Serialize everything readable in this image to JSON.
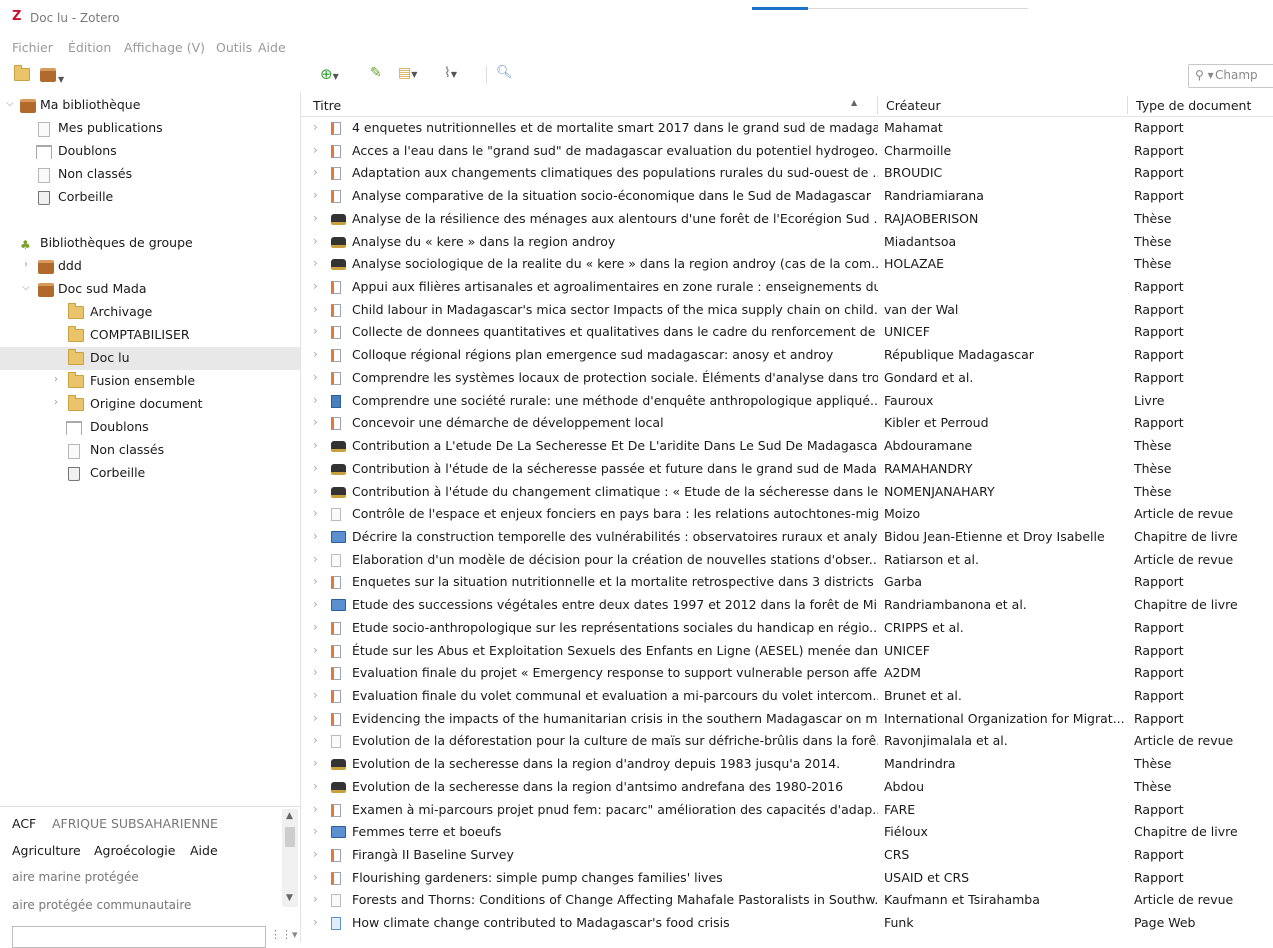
{
  "window": {
    "title": "Doc lu - Zotero",
    "logo": "Z"
  },
  "menu": [
    "Fichier",
    "Édition",
    "Affichage (V)",
    "Outils",
    "Aide"
  ],
  "toolbar": {
    "search_placeholder": "Champ"
  },
  "sidebar": {
    "my_library": "Ma bibliothèque",
    "my_items": [
      "Mes publications",
      "Doublons",
      "Non classés",
      "Corbeille"
    ],
    "groups_header": "Bibliothèques de groupe",
    "groups": [
      {
        "label": "ddd"
      },
      {
        "label": "Doc sud Mada"
      }
    ],
    "doc_sud_children": [
      "Archivage",
      "COMPTABILISER",
      "Doc lu",
      "Fusion ensemble",
      "Origine document",
      "Doublons",
      "Non classés",
      "Corbeille"
    ]
  },
  "tags": {
    "row1": [
      "ACF",
      "AFRIQUE SUBSAHARIENNE"
    ],
    "row2": [
      "Agriculture",
      "Agroécologie",
      "Aide"
    ],
    "row3": [
      "aire marine protégée"
    ],
    "row4": [
      "aire protégée communautaire"
    ]
  },
  "columns": {
    "title": "Titre",
    "creator": "Créateur",
    "type": "Type de document"
  },
  "rows": [
    {
      "icon": "report",
      "title": "4 enquetes nutritionnelles et de mortalite smart 2017 dans le grand sud de madaga...",
      "creator": "Mahamat",
      "type": "Rapport"
    },
    {
      "icon": "report",
      "title": "Acces a l'eau dans le \"grand sud\" de madagascar evaluation du potentiel hydrogeo...",
      "creator": "Charmoille",
      "type": "Rapport"
    },
    {
      "icon": "report",
      "title": "Adaptation aux changements climatiques des populations rurales du sud-ouest de ...",
      "creator": "BROUDIC",
      "type": "Rapport"
    },
    {
      "icon": "report",
      "title": "Analyse comparative de la situation socio-économique dans le Sud de Madagascar",
      "creator": "Randriamiarana",
      "type": "Rapport"
    },
    {
      "icon": "thesis",
      "title": "Analyse de la résilience des ménages aux alentours d'une forêt de l'Ecorégion Sud ...",
      "creator": "RAJAOBERISON",
      "type": "Thèse"
    },
    {
      "icon": "thesis",
      "title": "Analyse du « kere » dans la region androy",
      "creator": "Miadantsoa",
      "type": "Thèse"
    },
    {
      "icon": "thesis",
      "title": "Analyse sociologique de la realite du « kere » dans la region androy (cas de la com...",
      "creator": "HOLAZAE",
      "type": "Thèse"
    },
    {
      "icon": "report",
      "title": "Appui aux filières artisanales et agroalimentaires en zone rurale : enseignements du...",
      "creator": "",
      "type": "Rapport"
    },
    {
      "icon": "report",
      "title": "Child labour in Madagascar's mica sector Impacts of the mica supply chain on child...",
      "creator": "van der Wal",
      "type": "Rapport"
    },
    {
      "icon": "report",
      "title": "Collecte de donnees quantitatives et qualitatives dans le cadre du renforcement de ...",
      "creator": "UNICEF",
      "type": "Rapport"
    },
    {
      "icon": "report",
      "title": "Colloque régional régions plan emergence sud madagascar: anosy et androy",
      "creator": "République Madagascar",
      "type": "Rapport"
    },
    {
      "icon": "report",
      "title": "Comprendre les systèmes locaux de protection sociale. Éléments d'analyse dans troi...",
      "creator": "Gondard et al.",
      "type": "Rapport"
    },
    {
      "icon": "book",
      "title": "Comprendre une société rurale: une méthode d'enquête anthropologique appliqué...",
      "creator": "Fauroux",
      "type": "Livre"
    },
    {
      "icon": "report",
      "title": "Concevoir une démarche de développement local",
      "creator": "Kibler et Perroud",
      "type": "Rapport"
    },
    {
      "icon": "thesis",
      "title": "Contribution a L'etude De La Secheresse Et De L'aridite Dans Le Sud De Madagascar",
      "creator": "Abdouramane",
      "type": "Thèse"
    },
    {
      "icon": "thesis",
      "title": "Contribution à l'étude de la sécheresse passée et future dans le grand sud de Mada...",
      "creator": "RAMAHANDRY",
      "type": "Thèse"
    },
    {
      "icon": "thesis",
      "title": "Contribution à l'étude du changement climatique : « Etude de la sécheresse dans le ...",
      "creator": "NOMENJANAHARY",
      "type": "Thèse"
    },
    {
      "icon": "article",
      "title": "Contrôle de l'espace et enjeux fonciers en pays bara : les relations autochtones-mig...",
      "creator": "Moizo",
      "type": "Article de revue"
    },
    {
      "icon": "chapter",
      "title": "Décrire la construction temporelle des vulnérabilités : observatoires ruraux et analys...",
      "creator": "Bidou Jean-Etienne et Droy Isabelle",
      "type": "Chapitre de livre"
    },
    {
      "icon": "article",
      "title": "Elaboration d'un modèle de décision pour la création de nouvelles stations d'obser...",
      "creator": "Ratiarson et al.",
      "type": "Article de revue"
    },
    {
      "icon": "report",
      "title": "Enquetes sur la situation nutritionnelle et la mortalite retrospective dans 3 districts ...",
      "creator": "Garba",
      "type": "Rapport"
    },
    {
      "icon": "chapter",
      "title": "Etude des successions végétales entre deux dates 1997 et 2012 dans la forêt de Mik...",
      "creator": "Randriambanona et al.",
      "type": "Chapitre de livre"
    },
    {
      "icon": "report",
      "title": "Etude socio-anthropologique sur les représentations sociales du handicap en régio...",
      "creator": "CRIPPS et al.",
      "type": "Rapport"
    },
    {
      "icon": "report",
      "title": "Étude sur les Abus et Exploitation Sexuels des Enfants en Ligne (AESEL) menée dans...",
      "creator": "UNICEF",
      "type": "Rapport"
    },
    {
      "icon": "report",
      "title": "Evaluation finale du projet « Emergency response to support vulnerable person affe...",
      "creator": "A2DM",
      "type": "Rapport"
    },
    {
      "icon": "report",
      "title": "Evaluation finale du volet communal et evaluation a mi-parcours du volet intercom...",
      "creator": "Brunet et al.",
      "type": "Rapport"
    },
    {
      "icon": "report",
      "title": "Evidencing the impacts of the humanitarian crisis in the southern Madagascar on mi...",
      "creator": "International Organization for Migrat...",
      "type": "Rapport"
    },
    {
      "icon": "article",
      "title": "Evolution de la déforestation pour la culture de maïs sur défriche-brûlis dans la forê...",
      "creator": "Ravonjimalala et al.",
      "type": "Article de revue"
    },
    {
      "icon": "thesis",
      "title": "Evolution de la secheresse dans la region d'androy depuis 1983 jusqu'a 2014.",
      "creator": "Mandrindra",
      "type": "Thèse"
    },
    {
      "icon": "thesis",
      "title": "Evolution de la secheresse dans la region d'antsimo andrefana des 1980-2016",
      "creator": "Abdou",
      "type": "Thèse"
    },
    {
      "icon": "report",
      "title": "Examen à mi-parcours projet pnud fem: pacarc\" amélioration des capacités d'adap...",
      "creator": "FARE",
      "type": "Rapport"
    },
    {
      "icon": "chapter",
      "title": "Femmes terre et boeufs",
      "creator": "Fiéloux",
      "type": "Chapitre de livre"
    },
    {
      "icon": "report",
      "title": "Firangà II Baseline Survey",
      "creator": "CRS",
      "type": "Rapport"
    },
    {
      "icon": "report",
      "title": "Flourishing gardeners: simple pump changes families' lives",
      "creator": "USAID et CRS",
      "type": "Rapport"
    },
    {
      "icon": "article",
      "title": "Forests and Thorns: Conditions of Change Affecting Mahafale Pastoralists in Southw...",
      "creator": "Kaufmann et Tsirahamba",
      "type": "Article de revue"
    },
    {
      "icon": "web",
      "title": "How climate change contributed to Madagascar's food crisis",
      "creator": "Funk",
      "type": "Page Web"
    }
  ]
}
